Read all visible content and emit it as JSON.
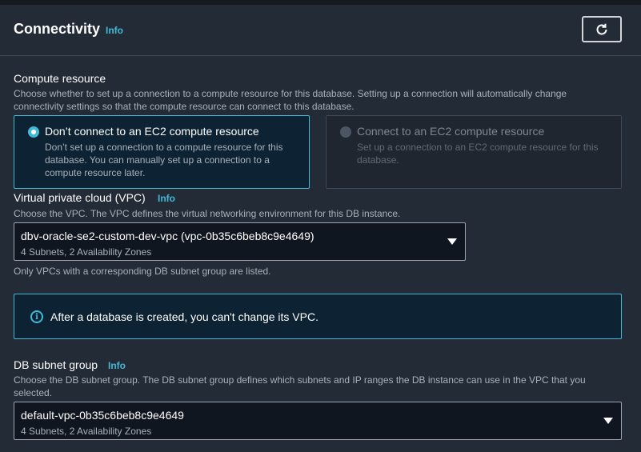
{
  "header": {
    "title": "Connectivity",
    "info": "Info"
  },
  "compute": {
    "label": "Compute resource",
    "description_line1": "Choose whether to set up a connection to a compute resource for this database. Setting up a connection will automatically change",
    "description_line2": "connectivity settings so that the compute resource can connect to this database.",
    "option_no": {
      "title": "Don’t connect to an EC2 compute resource",
      "desc_line1": "Don’t set up a connection to a compute resource for this",
      "desc_line2": "database. You can manually set up a connection to a",
      "desc_line3": "compute resource later.",
      "selected": true
    },
    "option_yes": {
      "title": "Connect to an EC2 compute resource",
      "desc_line1": "Set up a connection to an EC2 compute resource for this",
      "desc_line2": "database.",
      "selected": false
    }
  },
  "vpc": {
    "label": "Virtual private cloud (VPC)",
    "info": "Info",
    "description": "Choose the VPC. The VPC defines the virtual networking environment for this DB instance.",
    "selected_value": "dbv-oracle-se2-custom-dev-vpc (vpc-0b35c6beb8c9e4649)",
    "selected_sub": "4 Subnets, 2 Availability Zones",
    "hint": "Only VPCs with a corresponding DB subnet group are listed."
  },
  "alert": {
    "text": "After a database is created, you can't change its VPC.",
    "icon": "info-icon"
  },
  "subnet": {
    "label": "DB subnet group",
    "info": "Info",
    "description_line1": "Choose the DB subnet group. The DB subnet group defines which subnets and IP ranges the DB instance can use in the VPC that you",
    "description_line2": "selected.",
    "selected_value": "default-vpc-0b35c6beb8c9e4649",
    "selected_sub": "4 Subnets, 2 Availability Zones"
  },
  "colors": {
    "accent": "#44b9d6",
    "panel": "#222b36"
  }
}
